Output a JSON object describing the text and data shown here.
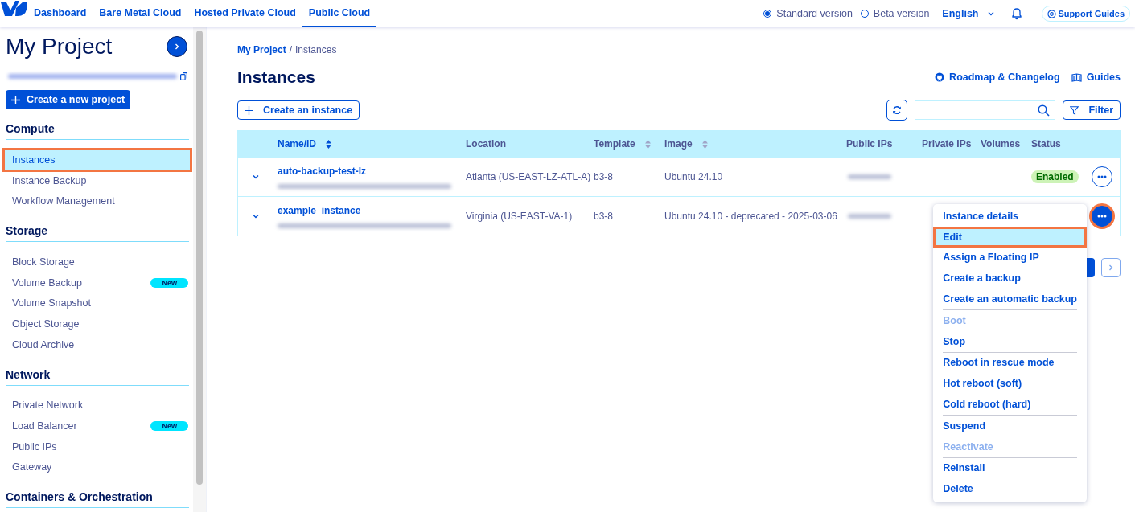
{
  "topnav": {
    "tabs": [
      {
        "label": "Dashboard",
        "selected": false
      },
      {
        "label": "Bare Metal Cloud",
        "selected": false
      },
      {
        "label": "Hosted Private Cloud",
        "selected": false
      },
      {
        "label": "Public Cloud",
        "selected": true
      }
    ],
    "versions": [
      {
        "label": "Standard version",
        "selected": true
      },
      {
        "label": "Beta version",
        "selected": false
      }
    ],
    "language": "English",
    "support": "Support Guides"
  },
  "sidebar": {
    "title": "My Project",
    "project_id_blurred": true,
    "create_button": "Create a new project",
    "sections": [
      {
        "heading": "Compute",
        "items": [
          {
            "label": "Instances",
            "selected": true,
            "highlighted": true
          },
          {
            "label": "Instance Backup",
            "selected": false
          },
          {
            "label": "Workflow Management",
            "selected": false
          }
        ]
      },
      {
        "heading": "Storage",
        "items": [
          {
            "label": "Block Storage",
            "selected": false
          },
          {
            "label": "Volume Backup",
            "selected": false,
            "badge": "New"
          },
          {
            "label": "Volume Snapshot",
            "selected": false
          },
          {
            "label": "Object Storage",
            "selected": false
          },
          {
            "label": "Cloud Archive",
            "selected": false
          }
        ]
      },
      {
        "heading": "Network",
        "items": [
          {
            "label": "Private Network",
            "selected": false
          },
          {
            "label": "Load Balancer",
            "selected": false,
            "badge": "New"
          },
          {
            "label": "Public IPs",
            "selected": false
          },
          {
            "label": "Gateway",
            "selected": false
          }
        ]
      },
      {
        "heading": "Containers & Orchestration"
      }
    ]
  },
  "breadcrumb": {
    "items": [
      {
        "label": "My Project",
        "kind": "link"
      },
      {
        "label": "Instances",
        "kind": "current"
      }
    ],
    "separator": "/"
  },
  "page": {
    "title": "Instances",
    "links": [
      {
        "label": "Roadmap & Changelog",
        "kind": "github"
      },
      {
        "label": "Guides",
        "kind": "book"
      }
    ],
    "create_button": "Create an instance",
    "filter_button": "Filter"
  },
  "table": {
    "columns": [
      {
        "label": "Name/ID",
        "sortable": true,
        "sorted": true
      },
      {
        "label": "Location",
        "sortable": false,
        "sorted": false
      },
      {
        "label": "Template",
        "sortable": true,
        "sorted": false
      },
      {
        "label": "Image",
        "sortable": true,
        "sorted": false
      },
      {
        "label": "Public IPs",
        "sortable": false,
        "sorted": false
      },
      {
        "label": "Private IPs",
        "sortable": false,
        "sorted": false
      },
      {
        "label": "Volumes",
        "sortable": false,
        "sorted": false
      },
      {
        "label": "Status",
        "sortable": false,
        "sorted": false
      }
    ],
    "rows": [
      {
        "name": "auto-backup-test-lz",
        "id_blurred": true,
        "location": "Atlanta (US-EAST-LZ-ATL-A)",
        "template": "b3-8",
        "image": "Ubuntu 24.10",
        "public_ip_blurred": true,
        "status": "Enabled",
        "menu_open": false,
        "highlighted": false
      },
      {
        "name": "example_instance",
        "id_blurred": true,
        "location": "Virginia (US-EAST-VA-1)",
        "template": "b3-8",
        "image": "Ubuntu 24.10 - deprecated - 2025-03-06",
        "public_ip_blurred": true,
        "menu_open": true,
        "highlighted": true
      }
    ]
  },
  "pagination": {
    "kind": "pager"
  },
  "action_menu": {
    "groups": [
      [
        {
          "label": "Instance details",
          "disabled": false,
          "highlighted": false
        },
        {
          "label": "Edit",
          "disabled": false,
          "highlighted": true
        },
        {
          "label": "Assign a Floating IP",
          "disabled": false,
          "highlighted": false
        },
        {
          "label": "Create a backup",
          "disabled": false,
          "highlighted": false
        },
        {
          "label": "Create an automatic backup",
          "disabled": false,
          "highlighted": false
        }
      ],
      [
        {
          "label": "Boot",
          "disabled": true,
          "highlighted": false
        },
        {
          "label": "Stop",
          "disabled": false,
          "highlighted": false
        }
      ],
      [
        {
          "label": "Reboot in rescue mode",
          "disabled": false,
          "highlighted": false
        },
        {
          "label": "Hot reboot (soft)",
          "disabled": false,
          "highlighted": false
        },
        {
          "label": "Cold reboot (hard)",
          "disabled": false,
          "highlighted": false
        }
      ],
      [
        {
          "label": "Suspend",
          "disabled": false,
          "highlighted": false
        },
        {
          "label": "Reactivate",
          "disabled": true,
          "highlighted": false
        }
      ],
      [
        {
          "label": "Reinstall",
          "disabled": false,
          "highlighted": false
        },
        {
          "label": "Delete",
          "disabled": false,
          "highlighted": false
        }
      ]
    ]
  }
}
